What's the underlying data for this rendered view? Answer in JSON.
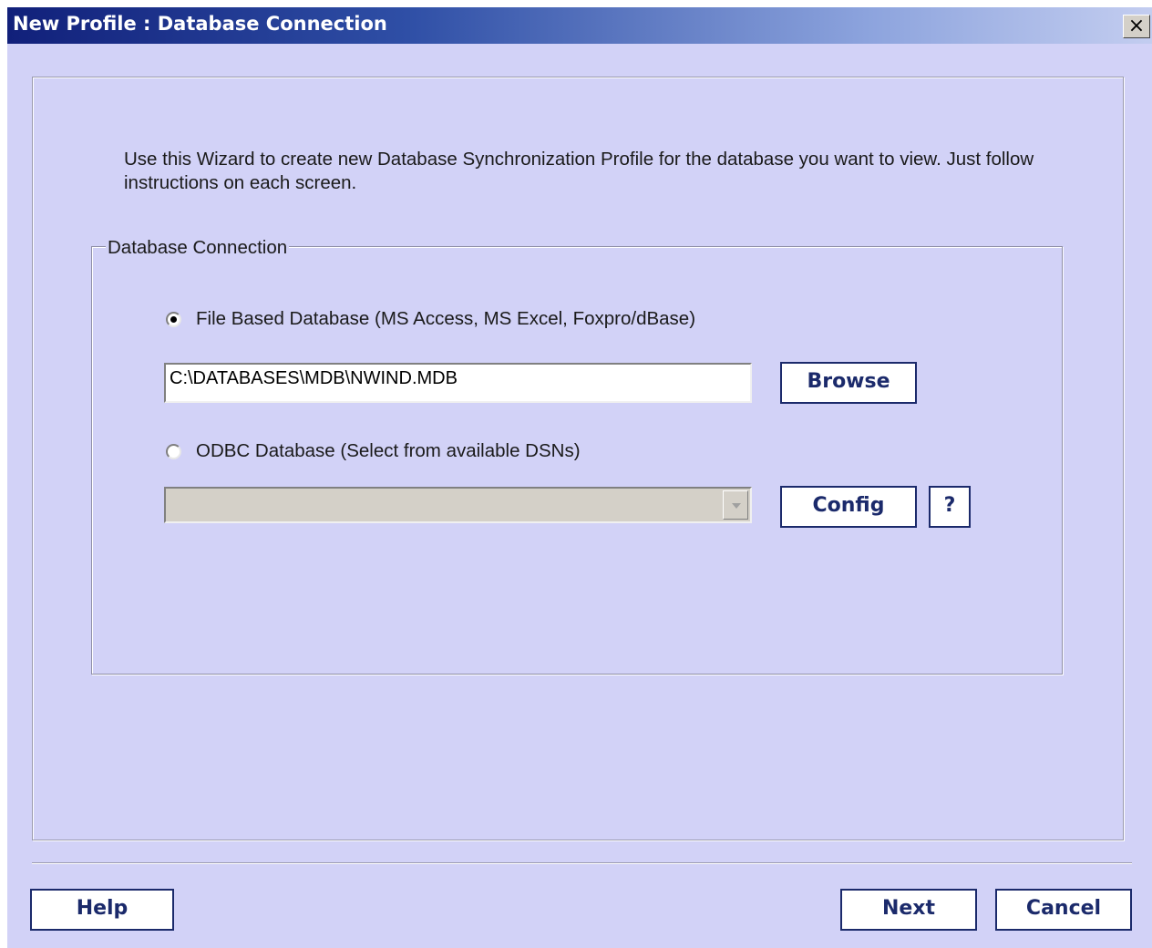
{
  "window": {
    "title": "New Profile : Database Connection",
    "close_label": "×"
  },
  "intro": {
    "text": "Use this Wizard to create new Database Synchronization Profile for the database you want to view. Just follow instructions on each screen."
  },
  "connection": {
    "legend": "Database Connection",
    "file_option": {
      "label": "File Based Database (MS Access, MS Excel, Foxpro/dBase)",
      "selected": true
    },
    "path_value": "C:\\DATABASES\\MDB\\NWIND.MDB",
    "browse_label": "Browse",
    "odbc_option": {
      "label": "ODBC Database (Select from available DSNs)",
      "selected": false
    },
    "dsn_value": "",
    "config_label": "Config",
    "help_q_label": "?"
  },
  "footer": {
    "help_label": "Help",
    "next_label": "Next",
    "cancel_label": "Cancel"
  },
  "colors": {
    "dialog_bg": "#d2d2f7",
    "title_gradient_start": "#11207a",
    "button_text": "#1b2a6b"
  },
  "icons": {
    "close": "close-icon",
    "dropdown": "chevron-down-icon"
  }
}
